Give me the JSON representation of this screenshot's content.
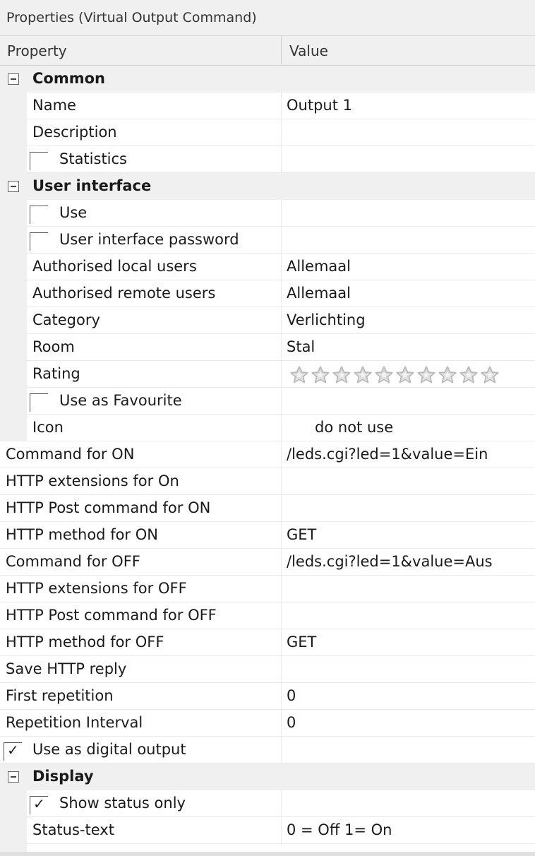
{
  "window": {
    "title": "Properties (Virtual Output Command)"
  },
  "header": {
    "property": "Property",
    "value": "Value"
  },
  "rows": [
    {
      "type": "category",
      "label": "Common"
    },
    {
      "type": "prop",
      "indent": true,
      "label": "Name",
      "value": "Output 1"
    },
    {
      "type": "prop",
      "indent": true,
      "label": "Description",
      "value": ""
    },
    {
      "type": "check",
      "indent": true,
      "label": "Statistics",
      "checked": false
    },
    {
      "type": "category",
      "label": "User interface"
    },
    {
      "type": "check",
      "indent": true,
      "label": "Use",
      "checked": false
    },
    {
      "type": "check",
      "indent": true,
      "label": "User interface password",
      "checked": false
    },
    {
      "type": "prop",
      "indent": true,
      "label": "Authorised local users",
      "value": "Allemaal"
    },
    {
      "type": "prop",
      "indent": true,
      "label": "Authorised remote users",
      "value": "Allemaal"
    },
    {
      "type": "prop",
      "indent": true,
      "label": "Category",
      "value": "Verlichting"
    },
    {
      "type": "prop",
      "indent": true,
      "label": "Room",
      "value": "Stal"
    },
    {
      "type": "rating",
      "indent": true,
      "label": "Rating",
      "stars": 10,
      "filled": 0
    },
    {
      "type": "check",
      "indent": true,
      "label": "Use as Favourite",
      "checked": false
    },
    {
      "type": "prop",
      "indent": true,
      "label": "Icon",
      "value": "      do not use"
    },
    {
      "type": "prop",
      "indent": false,
      "label": "Command for ON",
      "value": "/leds.cgi?led=1&value=Ein"
    },
    {
      "type": "prop",
      "indent": false,
      "label": "HTTP extensions for On",
      "value": ""
    },
    {
      "type": "prop",
      "indent": false,
      "label": "HTTP Post command for ON",
      "value": ""
    },
    {
      "type": "prop",
      "indent": false,
      "label": "HTTP method for ON",
      "value": "GET"
    },
    {
      "type": "prop",
      "indent": false,
      "label": "Command for OFF",
      "value": "/leds.cgi?led=1&value=Aus"
    },
    {
      "type": "prop",
      "indent": false,
      "label": "HTTP extensions for OFF",
      "value": ""
    },
    {
      "type": "prop",
      "indent": false,
      "label": "HTTP Post command for OFF",
      "value": ""
    },
    {
      "type": "prop",
      "indent": false,
      "label": "HTTP method for OFF",
      "value": "GET"
    },
    {
      "type": "prop",
      "indent": false,
      "label": "Save HTTP reply",
      "value": ""
    },
    {
      "type": "prop",
      "indent": false,
      "label": "First repetition",
      "value": "0"
    },
    {
      "type": "prop",
      "indent": false,
      "label": "Repetition Interval",
      "value": "0"
    },
    {
      "type": "check",
      "indent": false,
      "label": "Use as digital output",
      "checked": true
    },
    {
      "type": "category",
      "label": "Display"
    },
    {
      "type": "check",
      "indent": true,
      "label": "Show status only",
      "checked": true
    },
    {
      "type": "prop",
      "indent": true,
      "label": "Status-text",
      "value": "0 = Off 1= On"
    }
  ],
  "colors": {
    "gutter": "#f0f0f0",
    "line": "#e9e9e9",
    "star": "#b8b8b8"
  },
  "icons": {
    "expander": "collapse-minus-icon",
    "check": "checkmark-icon",
    "star": "star-outline-icon"
  }
}
